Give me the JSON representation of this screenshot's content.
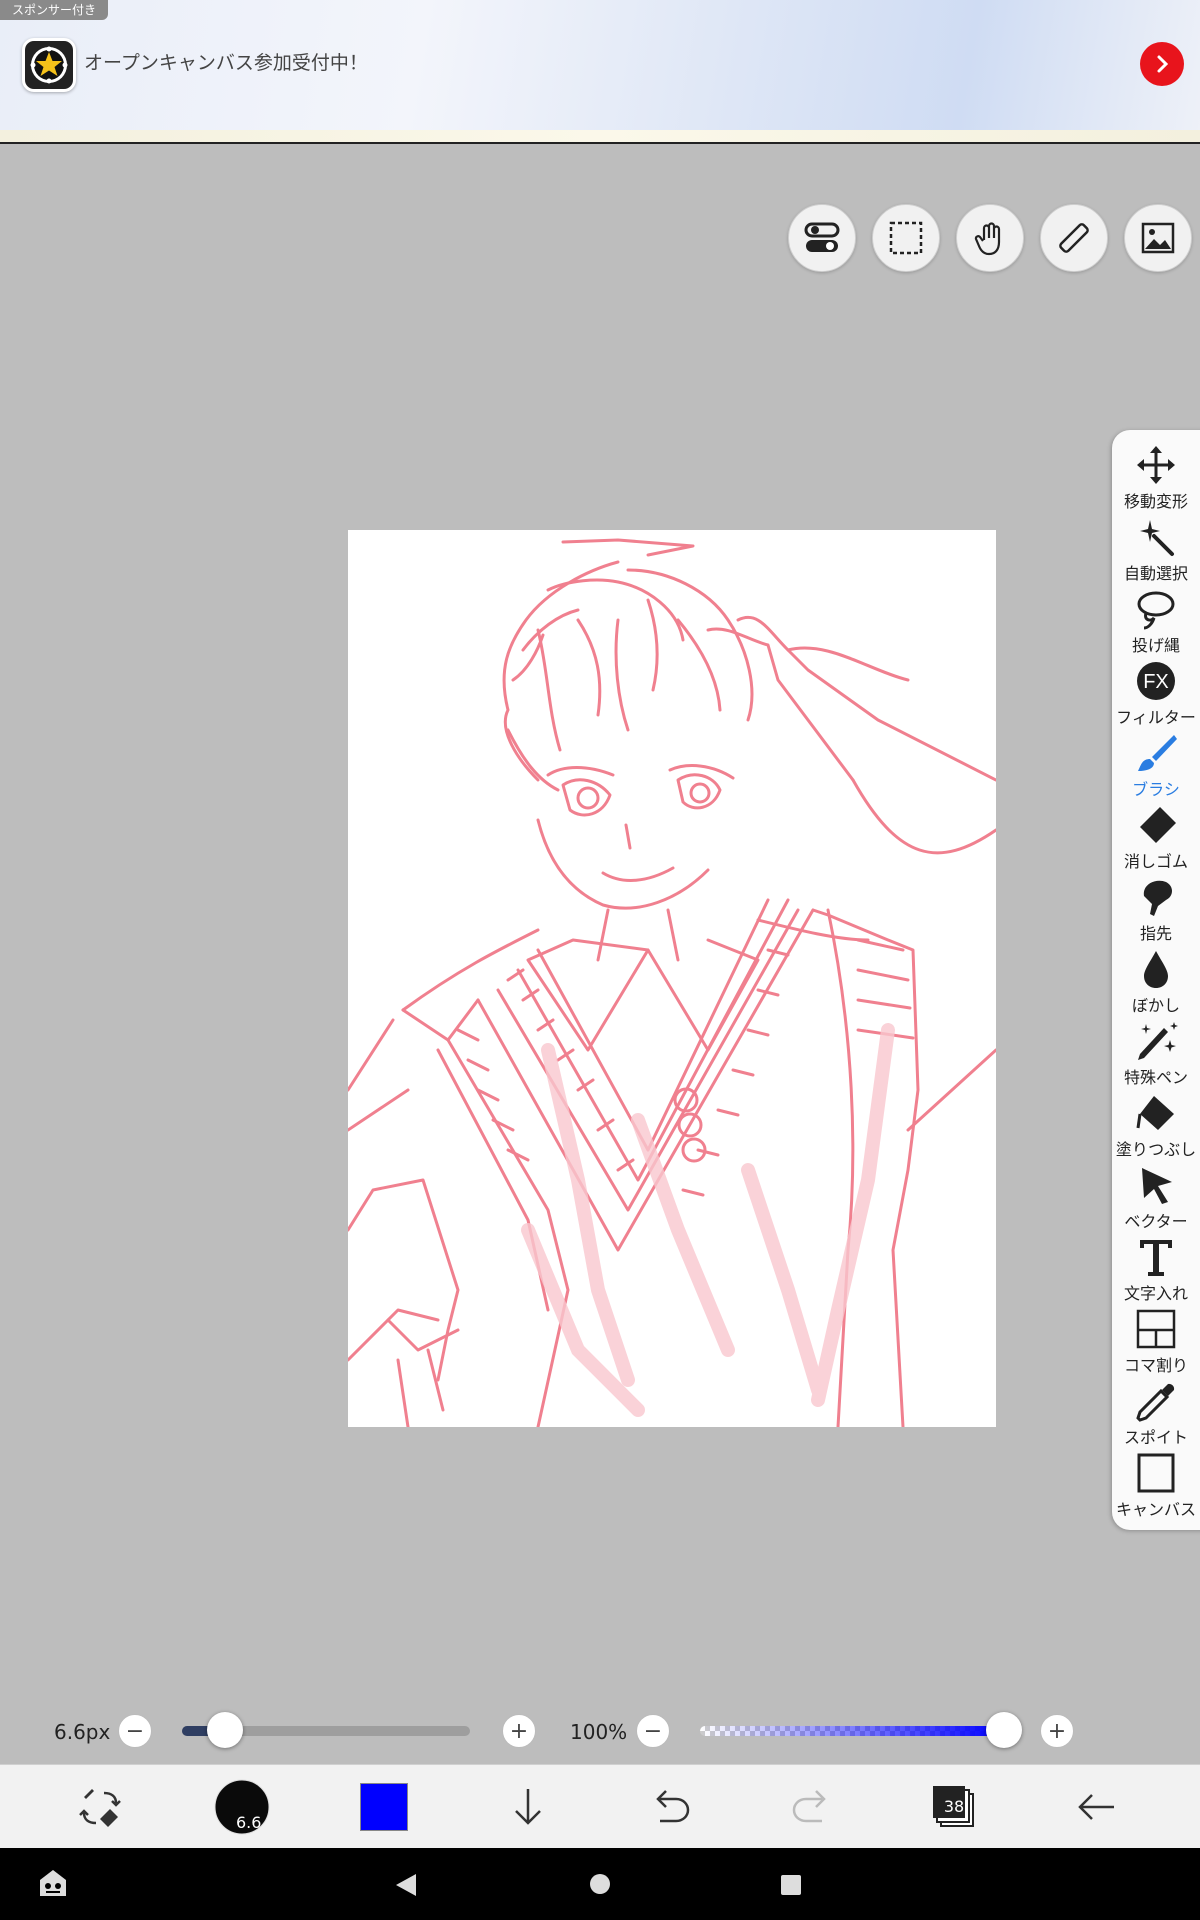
{
  "ad": {
    "sponsor_label": "スポンサー付き",
    "text": "オープンキャンバス参加受付中！"
  },
  "top_buttons": [
    "toggle-icon",
    "selection-icon",
    "hand-icon",
    "ruler-icon",
    "image-icon"
  ],
  "tools": [
    {
      "id": "move",
      "label": "移動変形",
      "icon": "move-icon"
    },
    {
      "id": "auto-select",
      "label": "自動選択",
      "icon": "magic-wand-icon"
    },
    {
      "id": "lasso",
      "label": "投げ縄",
      "icon": "lasso-icon"
    },
    {
      "id": "filter",
      "label": "フィルター",
      "icon": "fx-icon"
    },
    {
      "id": "brush",
      "label": "ブラシ",
      "icon": "brush-icon",
      "active": true
    },
    {
      "id": "eraser",
      "label": "消しゴム",
      "icon": "eraser-icon"
    },
    {
      "id": "finger",
      "label": "指先",
      "icon": "smudge-icon"
    },
    {
      "id": "blur",
      "label": "ぼかし",
      "icon": "drop-icon"
    },
    {
      "id": "special-pen",
      "label": "特殊ペン",
      "icon": "sparkle-pen-icon"
    },
    {
      "id": "fill",
      "label": "塗りつぶし",
      "icon": "bucket-icon"
    },
    {
      "id": "vector",
      "label": "ベクター",
      "icon": "arrow-cursor-icon"
    },
    {
      "id": "text",
      "label": "文字入れ",
      "icon": "text-icon"
    },
    {
      "id": "panel",
      "label": "コマ割り",
      "icon": "panel-icon"
    },
    {
      "id": "eyedropper",
      "label": "スポイト",
      "icon": "eyedropper-icon"
    },
    {
      "id": "canvas",
      "label": "キャンバス",
      "icon": "canvas-icon"
    }
  ],
  "brush": {
    "size_label": "6.6px",
    "size_fraction": 0.15,
    "opacity_label": "100%",
    "opacity_fraction": 1.0,
    "preview_label": "6.6"
  },
  "bottom_bar": {
    "color": "#0000ff",
    "layers_count": "38"
  },
  "colors": {
    "accent": "#2a7de1",
    "sketch": "#f0808f",
    "ad_button": "#e8141c"
  }
}
